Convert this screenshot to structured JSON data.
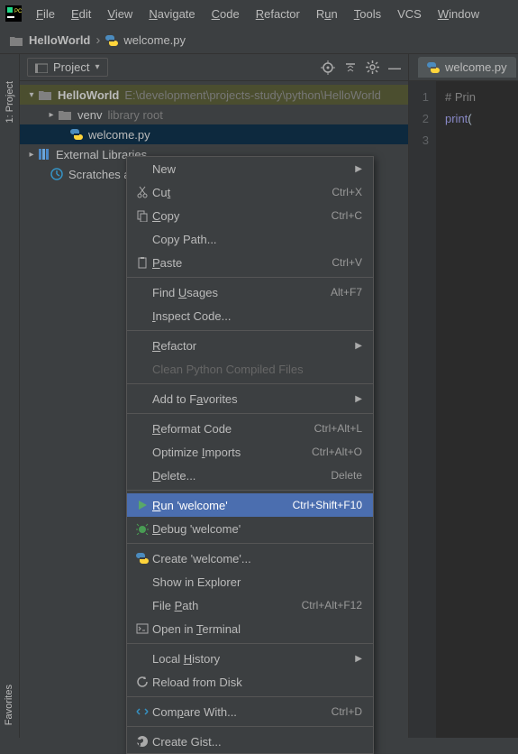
{
  "menubar": [
    "File",
    "Edit",
    "View",
    "Navigate",
    "Code",
    "Refactor",
    "Run",
    "Tools",
    "VCS",
    "Window"
  ],
  "menubar_underline": [
    0,
    0,
    0,
    0,
    0,
    0,
    1,
    0,
    -1,
    0
  ],
  "breadcrumb": {
    "folder": "HelloWorld",
    "file": "welcome.py"
  },
  "side_tabs": {
    "project": "1: Project",
    "favorites": "Favorites"
  },
  "project_panel": {
    "title": "Project",
    "tree": {
      "root": {
        "name": "HelloWorld",
        "path": "E:\\development\\projects-study\\python\\HelloWorld"
      },
      "venv": {
        "name": "venv",
        "hint": "library root"
      },
      "file": {
        "name": "welcome.py"
      },
      "external": "External Libraries",
      "scratches": "Scratches and Consoles"
    }
  },
  "editor": {
    "tab": "welcome.py",
    "gutter": [
      "1",
      "2",
      "3"
    ],
    "lines": [
      {
        "type": "comment",
        "text": "# Prin"
      },
      {
        "type": "code",
        "builtin": "print",
        "rest": "("
      },
      {
        "type": "blank",
        "text": ""
      }
    ]
  },
  "contextmenu": [
    {
      "type": "item",
      "label": "New",
      "icon": "",
      "arrow": true
    },
    {
      "type": "item",
      "label": "Cut",
      "u": 2,
      "icon": "cut",
      "short": "Ctrl+X"
    },
    {
      "type": "item",
      "label": "Copy",
      "u": 0,
      "icon": "copy",
      "short": "Ctrl+C"
    },
    {
      "type": "item",
      "label": "Copy Path...",
      "icon": ""
    },
    {
      "type": "item",
      "label": "Paste",
      "u": 0,
      "icon": "paste",
      "short": "Ctrl+V"
    },
    {
      "type": "sep"
    },
    {
      "type": "item",
      "label": "Find Usages",
      "u": 5,
      "icon": "",
      "short": "Alt+F7"
    },
    {
      "type": "item",
      "label": "Inspect Code...",
      "u": 0,
      "icon": ""
    },
    {
      "type": "sep"
    },
    {
      "type": "item",
      "label": "Refactor",
      "u": 0,
      "icon": "",
      "arrow": true
    },
    {
      "type": "item",
      "label": "Clean Python Compiled Files",
      "icon": "",
      "disabled": true
    },
    {
      "type": "sep"
    },
    {
      "type": "item",
      "label": "Add to Favorites",
      "u": 8,
      "icon": "",
      "arrow": true
    },
    {
      "type": "sep"
    },
    {
      "type": "item",
      "label": "Reformat Code",
      "u": 0,
      "icon": "",
      "short": "Ctrl+Alt+L"
    },
    {
      "type": "item",
      "label": "Optimize Imports",
      "u": 9,
      "icon": "",
      "short": "Ctrl+Alt+O"
    },
    {
      "type": "item",
      "label": "Delete...",
      "u": 0,
      "icon": "",
      "short": "Delete"
    },
    {
      "type": "sep"
    },
    {
      "type": "item",
      "label": "Run 'welcome'",
      "u": 0,
      "icon": "run",
      "short": "Ctrl+Shift+F10",
      "hl": true
    },
    {
      "type": "item",
      "label": "Debug 'welcome'",
      "u": 0,
      "icon": "debug"
    },
    {
      "type": "sep"
    },
    {
      "type": "item",
      "label": "Create 'welcome'...",
      "icon": "python"
    },
    {
      "type": "item",
      "label": "Show in Explorer",
      "icon": ""
    },
    {
      "type": "item",
      "label": "File Path",
      "u": 5,
      "icon": "",
      "short": "Ctrl+Alt+F12"
    },
    {
      "type": "item",
      "label": "Open in Terminal",
      "u": 8,
      "icon": "terminal"
    },
    {
      "type": "sep"
    },
    {
      "type": "item",
      "label": "Local History",
      "u": 6,
      "icon": "",
      "arrow": true
    },
    {
      "type": "item",
      "label": "Reload from Disk",
      "icon": "reload"
    },
    {
      "type": "sep"
    },
    {
      "type": "item",
      "label": "Compare With...",
      "u": 3,
      "icon": "compare",
      "short": "Ctrl+D"
    },
    {
      "type": "sep"
    },
    {
      "type": "item",
      "label": "Create Gist...",
      "icon": "github"
    }
  ]
}
